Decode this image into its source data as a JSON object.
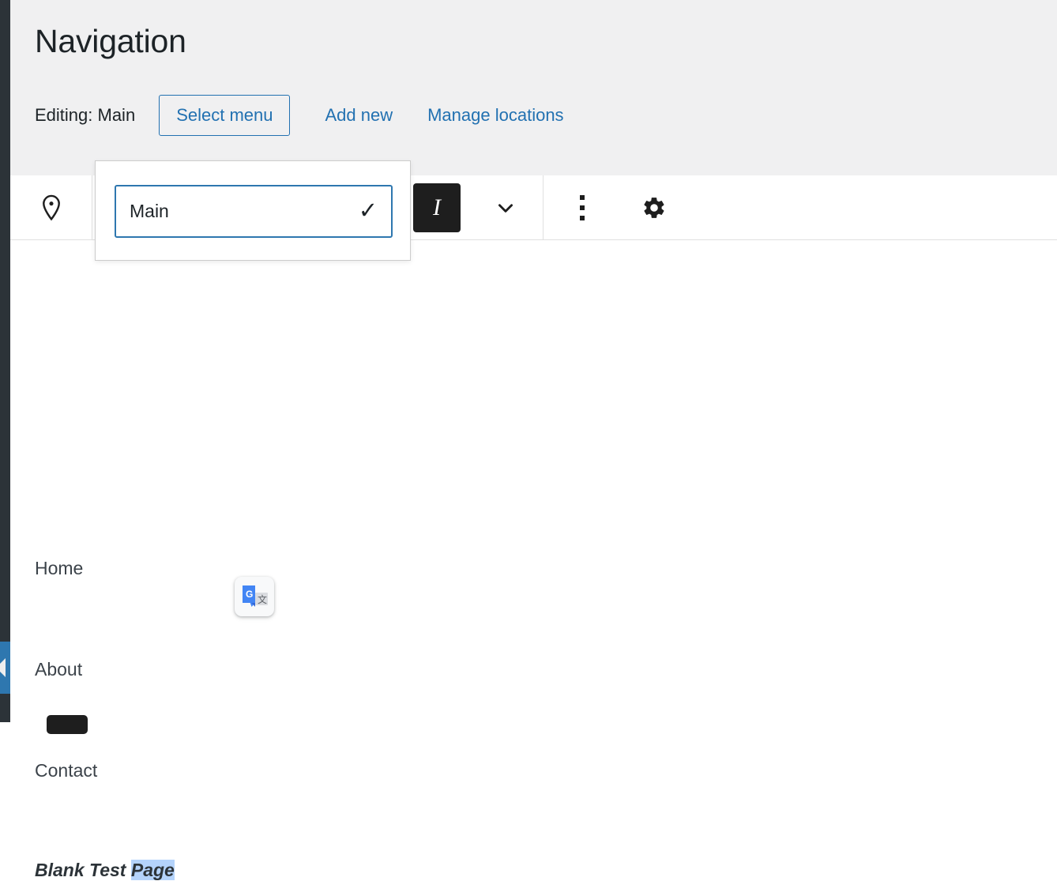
{
  "header": {
    "title": "Navigation",
    "editing_label": "Editing: Main",
    "select_menu_label": "Select menu",
    "links": [
      {
        "label": "Add new"
      },
      {
        "label": "Manage locations"
      }
    ],
    "background_color": "#f0f0f1",
    "link_color": "#2271b1"
  },
  "menu_popover": {
    "options": [
      {
        "label": "Main",
        "selected": true,
        "check_glyph": "✓"
      }
    ],
    "border_color": "#2e77af"
  },
  "toolbar": {
    "pin_icon": "location-pin-icon",
    "italic_button": {
      "label": "I",
      "active": true,
      "active_background": "#1e1e1e"
    },
    "chevron_icon": "chevron-down-icon",
    "more_icon": "vertical-dots-icon",
    "settings_icon": "gear-icon"
  },
  "menu_items": [
    {
      "label": "Home",
      "style": "normal"
    },
    {
      "label": "About",
      "style": "normal"
    },
    {
      "label": "Contact",
      "style": "normal"
    },
    {
      "label_plain": "Blank Test ",
      "label_selected": "Page",
      "style": "bold-italic",
      "selection_color": "#b4d3fb"
    }
  ],
  "overlays": {
    "translate_icon": "google-translate-icon"
  },
  "admin_rail": {
    "background_color": "#2c3338",
    "collapse_color": "#2e77af",
    "collapse_icon": "collapse-menu-arrow-icon"
  }
}
